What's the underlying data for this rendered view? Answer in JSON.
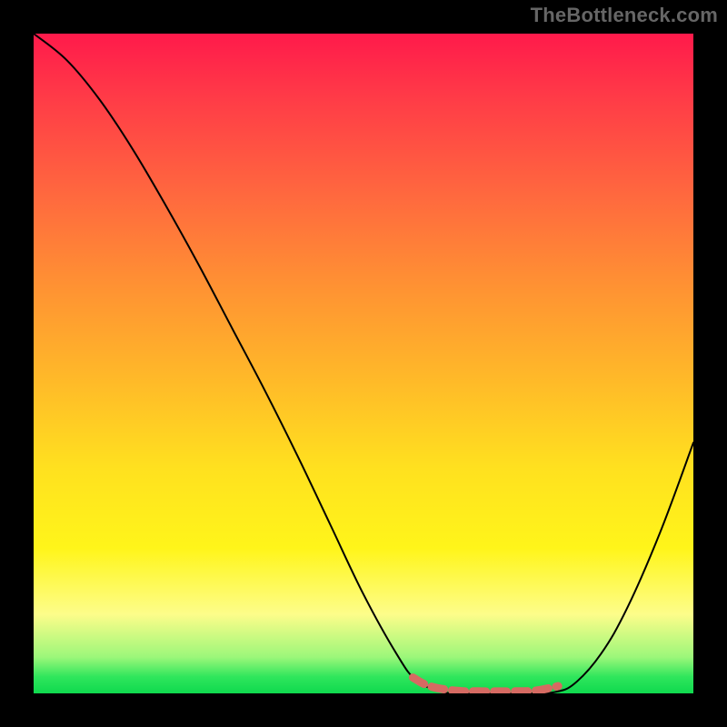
{
  "watermark": "TheBottleneck.com",
  "chart_data": {
    "type": "line",
    "title": "",
    "xlabel": "",
    "ylabel": "",
    "xlim": [
      0,
      100
    ],
    "ylim": [
      0,
      100
    ],
    "grid": false,
    "legend": false,
    "background_gradient": [
      "#ff1a4b",
      "#ff6a3e",
      "#ffe11f",
      "#0fd94e"
    ],
    "series": [
      {
        "name": "bottleneck-curve",
        "color": "#000000",
        "stroke_width": 2,
        "x": [
          0,
          5,
          10,
          15,
          20,
          25,
          30,
          35,
          40,
          45,
          50,
          55,
          58,
          62,
          66,
          70,
          75,
          79,
          82,
          86,
          90,
          95,
          100
        ],
        "values": [
          100,
          96,
          90,
          82.5,
          74,
          65,
          55.5,
          46,
          36,
          25.5,
          15,
          6,
          2,
          0.2,
          0,
          0,
          0,
          0.2,
          1.5,
          6,
          13,
          24.5,
          38
        ]
      },
      {
        "name": "optimal-band-marker",
        "color": "#d66a62",
        "stroke_width": 9,
        "dash": [
          14,
          9
        ],
        "x": [
          57.5,
          60,
          64,
          68,
          72,
          76,
          79.5
        ],
        "values": [
          2.4,
          1.1,
          0.4,
          0.3,
          0.3,
          0.4,
          1.1
        ]
      }
    ]
  }
}
